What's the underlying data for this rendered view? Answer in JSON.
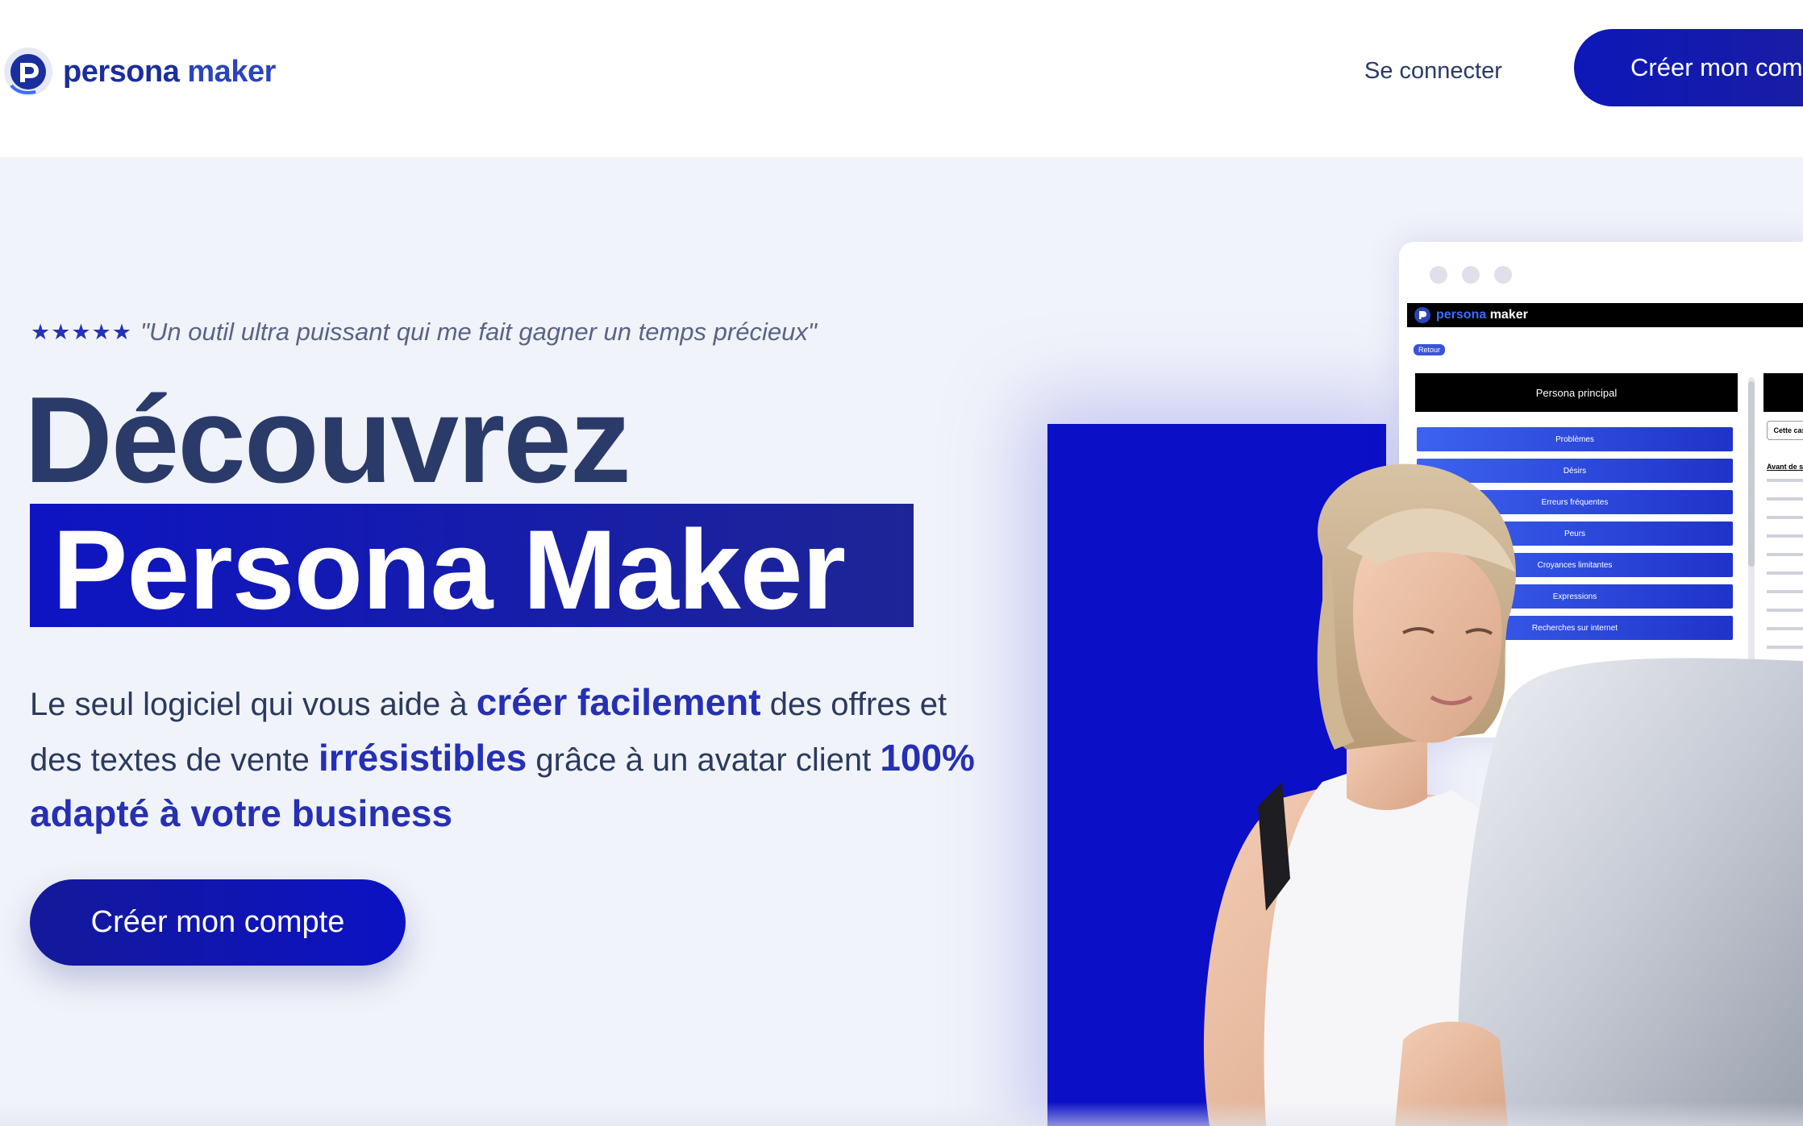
{
  "header": {
    "logo_text_1": "persona",
    "logo_text_2": "maker",
    "login_label": "Se connecter",
    "cta_label": "Créer mon compte"
  },
  "hero": {
    "stars": "★★★★★",
    "quote": "\"Un outil ultra puissant qui me fait gagner un temps précieux\"",
    "title_line1": "Découvrez",
    "title_line2": "Persona Maker",
    "desc_1": "Le seul logiciel qui vous aide à ",
    "desc_highlight_1": "créer facilement",
    "desc_2": " des offres et des textes de vente ",
    "desc_highlight_2": "irrésistibles",
    "desc_3": " grâce à un avatar client ",
    "desc_highlight_3": "100% adapté à votre business",
    "cta_label": "Créer mon compte"
  },
  "app_preview": {
    "logo_text_1": "persona",
    "logo_text_2": "maker",
    "back_label": "Retour",
    "panel_title": "Persona principal",
    "menu_items": [
      "Problèmes",
      "Désirs",
      "Erreurs fréquentes",
      "Peurs",
      "Croyances limitantes",
      "Expressions",
      "Recherches sur internet"
    ],
    "side_button": "Cette case",
    "side_heading": "Avant de se"
  },
  "colors": {
    "brand_blue": "#0b10c6",
    "text_dark": "#2a3b6a",
    "accent": "#2530b4"
  }
}
